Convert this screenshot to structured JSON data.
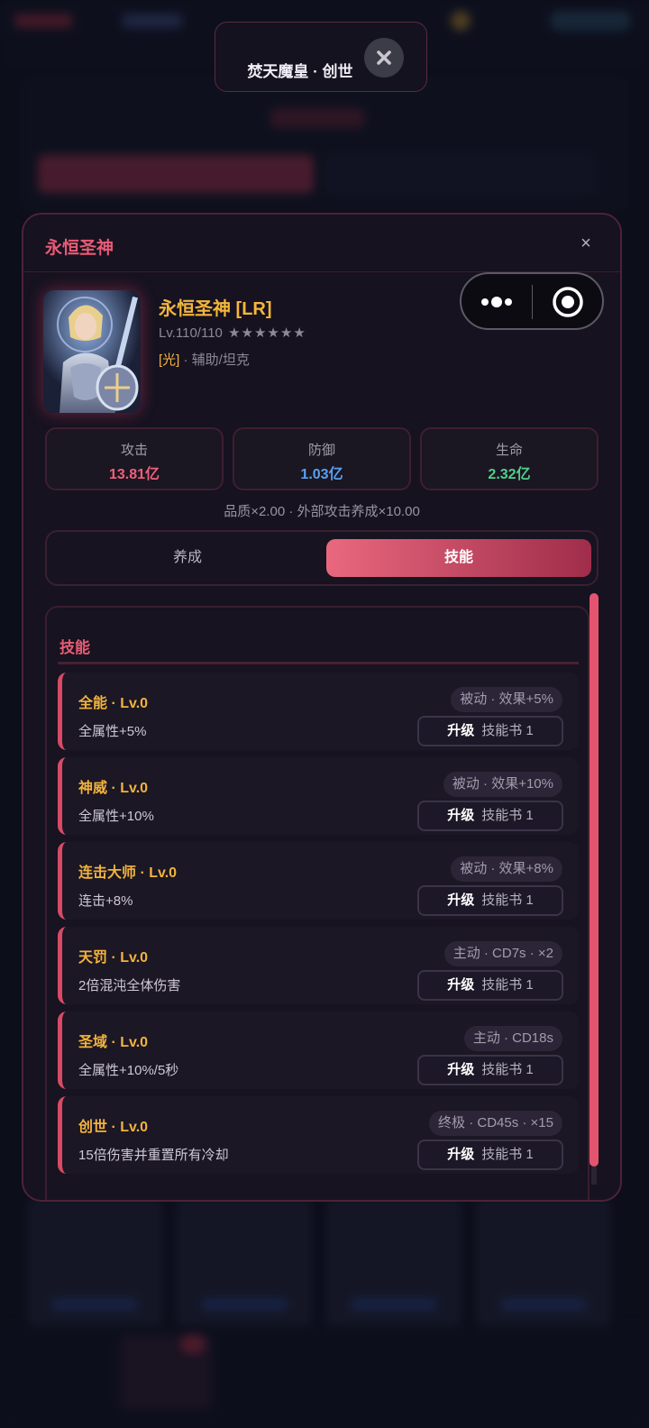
{
  "toast": {
    "text": "焚天魔皇 · 创世"
  },
  "modal": {
    "title": "永恒圣神",
    "close_label": "×"
  },
  "hero": {
    "name": "永恒圣神 [LR]",
    "level": "Lv.110/110",
    "stars": "★★★★★★",
    "element": "[光]",
    "role": " · 辅助/坦克"
  },
  "stats": [
    {
      "label": "攻击",
      "value": "13.81亿",
      "color": "#f0607a"
    },
    {
      "label": "防御",
      "value": "1.03亿",
      "color": "#5aa0f0"
    },
    {
      "label": "生命",
      "value": "2.32亿",
      "color": "#4fd08a"
    }
  ],
  "multiplier": "品质×2.00 · 外部攻击养成×10.00",
  "tabs": [
    {
      "label": "养成",
      "active": false
    },
    {
      "label": "技能",
      "active": true
    }
  ],
  "skills_section": {
    "title": "技能"
  },
  "skills": [
    {
      "name": "全能 · Lv.0",
      "desc": "全属性+5%",
      "tag": "被动 · 效果+5%",
      "upgrade": "升级",
      "cost": "技能书 1"
    },
    {
      "name": "神威 · Lv.0",
      "desc": "全属性+10%",
      "tag": "被动 · 效果+10%",
      "upgrade": "升级",
      "cost": "技能书 1"
    },
    {
      "name": "连击大师 · Lv.0",
      "desc": "连击+8%",
      "tag": "被动 · 效果+8%",
      "upgrade": "升级",
      "cost": "技能书 1"
    },
    {
      "name": "天罚 · Lv.0",
      "desc": "2倍混沌全体伤害",
      "tag": "主动 · CD7s · ×2",
      "upgrade": "升级",
      "cost": "技能书 1"
    },
    {
      "name": "圣域 · Lv.0",
      "desc": "全属性+10%/5秒",
      "tag": "主动 · CD18s",
      "upgrade": "升级",
      "cost": "技能书 1"
    },
    {
      "name": "创世 · Lv.0",
      "desc": "15倍伤害并重置所有冷却",
      "tag": "终极 · CD45s · ×15",
      "upgrade": "升级",
      "cost": "技能书 1"
    }
  ],
  "icons": {
    "toast_close": "close-icon",
    "capsule_more": "more-dots-icon",
    "capsule_close": "target-circle-icon"
  }
}
